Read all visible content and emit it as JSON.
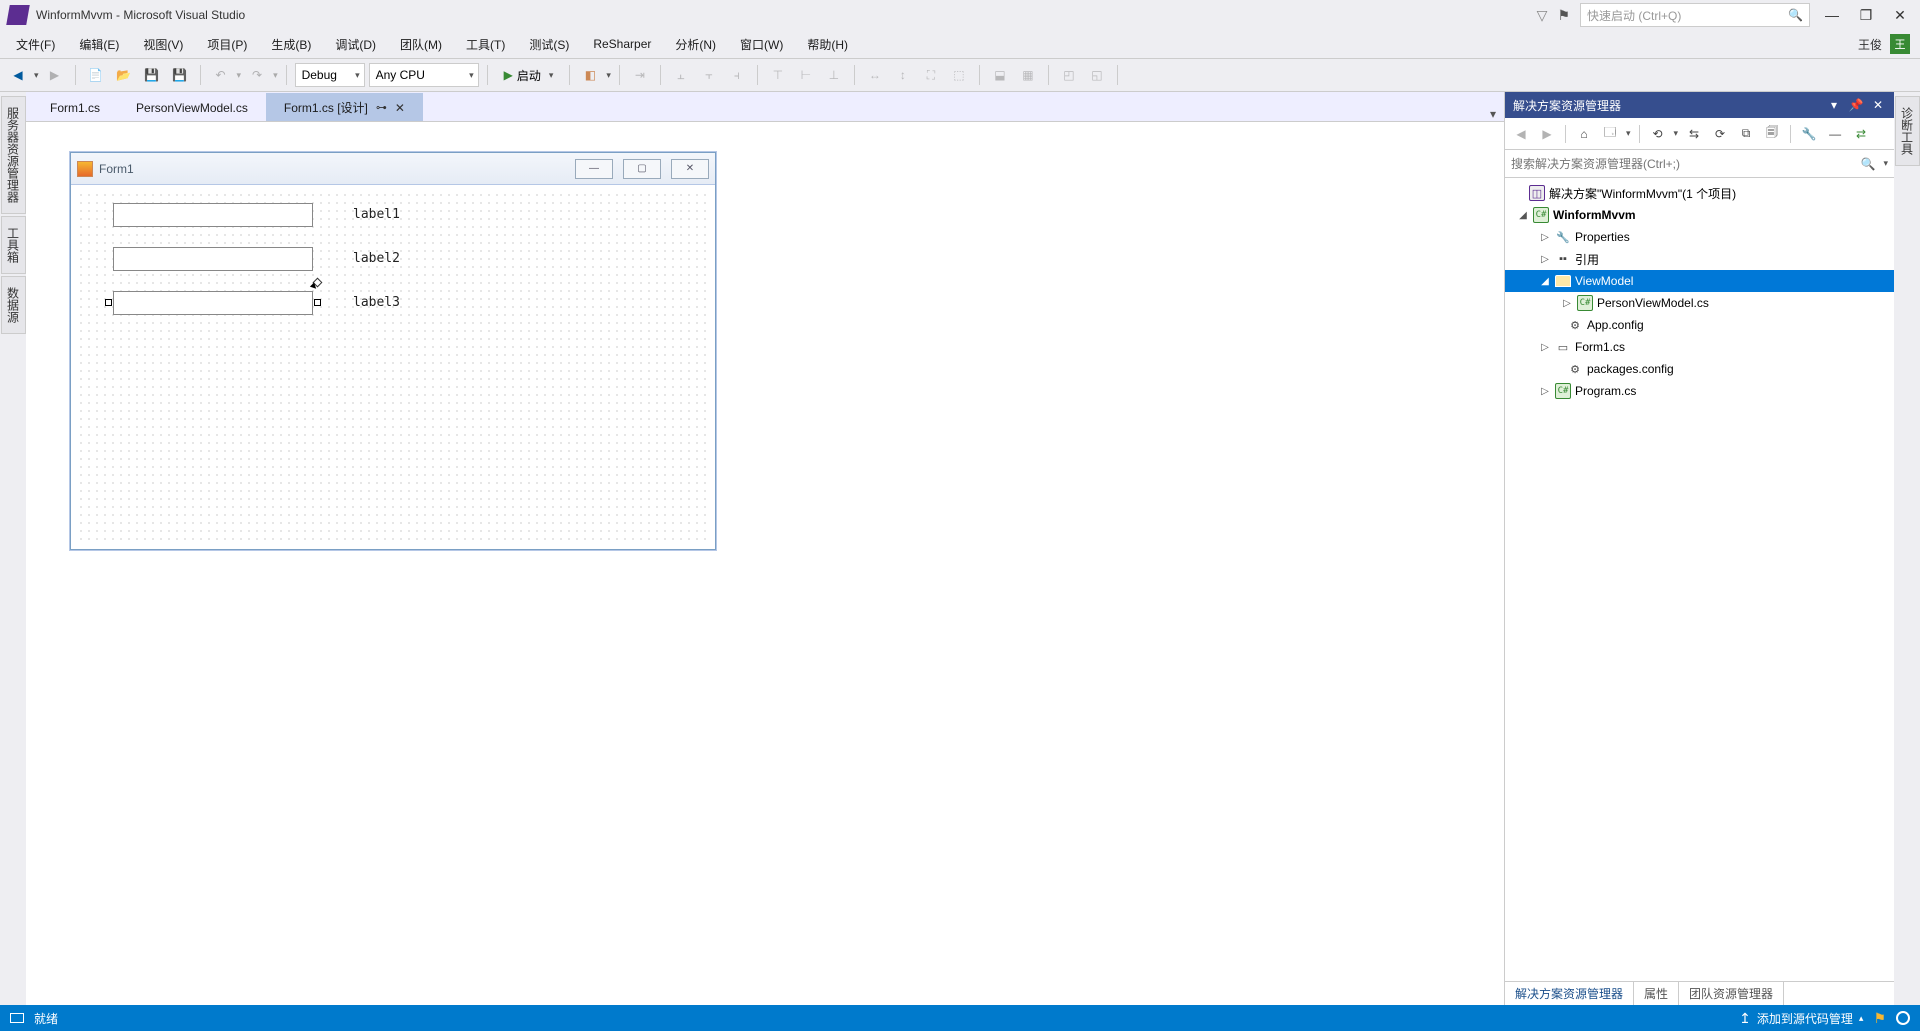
{
  "title": "WinformMvvm - Microsoft Visual Studio",
  "quick_launch_placeholder": "快速启动 (Ctrl+Q)",
  "user_name": "王俊",
  "user_initial": "王",
  "menus": [
    "文件(F)",
    "编辑(E)",
    "视图(V)",
    "项目(P)",
    "生成(B)",
    "调试(D)",
    "团队(M)",
    "工具(T)",
    "测试(S)",
    "ReSharper",
    "分析(N)",
    "窗口(W)",
    "帮助(H)"
  ],
  "toolbar": {
    "config": "Debug",
    "platform": "Any CPU",
    "start": "启动"
  },
  "left_tabs": [
    "服务器资源管理器",
    "工具箱",
    "数据源"
  ],
  "right_tab": "诊断工具",
  "doc_tabs": [
    {
      "label": "Form1.cs",
      "active": false
    },
    {
      "label": "PersonViewModel.cs",
      "active": false
    },
    {
      "label": "Form1.cs [设计]",
      "active": true
    }
  ],
  "form": {
    "title": "Form1",
    "labels": [
      "label1",
      "label2",
      "label3"
    ]
  },
  "solution_panel": {
    "header": "解决方案资源管理器",
    "search_placeholder": "搜索解决方案资源管理器(Ctrl+;)",
    "solution_text": "解决方案\"WinformMvvm\"(1 个项目)",
    "project": "WinformMvvm",
    "nodes": {
      "properties": "Properties",
      "references": "引用",
      "viewmodel": "ViewModel",
      "person_vm": "PersonViewModel.cs",
      "app_config": "App.config",
      "form1": "Form1.cs",
      "packages": "packages.config",
      "program": "Program.cs"
    },
    "bottom_tabs": [
      "解决方案资源管理器",
      "属性",
      "团队资源管理器"
    ]
  },
  "statusbar": {
    "ready": "就绪",
    "source_control": "添加到源代码管理"
  }
}
